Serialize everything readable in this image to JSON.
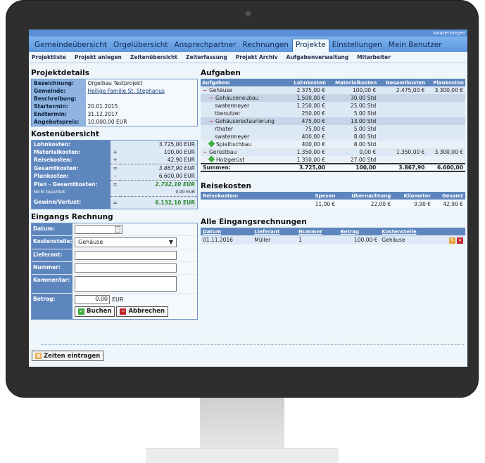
{
  "user": "swatermeyer",
  "main_nav": [
    "Gemeindeübersicht",
    "Orgelübersicht",
    "Ansprechpartner",
    "Rechnungen",
    "Projekte",
    "Einstellungen",
    "Mein Benutzer"
  ],
  "main_nav_active": "Projekte",
  "sub_nav": [
    "Projektliste",
    "Projekt anlegen",
    "Zeitenübersicht",
    "Zeiterfassung",
    "Projekt Archiv",
    "Aufgabenverwaltung",
    "Mitarbeiter"
  ],
  "projektdetails": {
    "title": "Projektdetails",
    "rows": [
      {
        "k": "Bezeichnung:",
        "v": "Orgelbau Testprojekt"
      },
      {
        "k": "Gemeinde:",
        "v": "Heilige Familie St. Stephanus"
      },
      {
        "k": "Beschreibung:",
        "v": ""
      },
      {
        "k": "Startermin:",
        "v": "20.01.2015"
      },
      {
        "k": "Endtermin:",
        "v": "31.12.2017"
      },
      {
        "k": "Angebotspreis:",
        "v": "10.000,00 EUR"
      }
    ]
  },
  "kosten": {
    "title": "Kostenübersicht",
    "rows": [
      {
        "k": "Lohnkosten:",
        "op": "",
        "v": "3.725,00 EUR"
      },
      {
        "k": "Materialkosten:",
        "op": "+",
        "v": "100,00 EUR"
      },
      {
        "k": "Reisekosten:",
        "op": "+",
        "v": "42,90 EUR"
      },
      {
        "k": "Gesamtkosten:",
        "op": "=",
        "v": "3.867,90 EUR"
      },
      {
        "k": "Plankosten:",
        "op": "-",
        "v": "6.600,00 EUR"
      },
      {
        "k": "Plan - Gesamtkosten:",
        "op": "=",
        "v": "2.732,10 EUR"
      },
      {
        "k": "Nicht beachtet:",
        "op": "",
        "v": "0,00 EUR"
      },
      {
        "k": "Gewinn/Verlust:",
        "op": "=",
        "v": "6.132,10 EUR"
      }
    ]
  },
  "eingang": {
    "title": "Eingangs Rechnung",
    "labels": {
      "datum": "Datum:",
      "kostenstelle": "Kostenstelle:",
      "lieferant": "Lieferant:",
      "nummer": "Nummer:",
      "kommentar": "Kommentar:",
      "betrag": "Betrag:"
    },
    "kostenstelle_value": "Gehäuse",
    "betrag_value": "0.00",
    "currency": "EUR",
    "buchen": "Buchen",
    "abbrechen": "Abbrechen"
  },
  "aufgaben": {
    "title": "Aufgaben",
    "headers": [
      "Aufgaben:",
      "Lohnkosten",
      "Materialkosten",
      "Gesamtkosten",
      "Plankosten"
    ],
    "rows": [
      {
        "level": 0,
        "marker": "minus",
        "name": "Gehäuse",
        "lohn": "2.375,00 €",
        "mat": "100,00 €",
        "ges": "2.475,00 €",
        "plan": "3.300,00 €"
      },
      {
        "level": 2,
        "marker": "minus",
        "name": "Gehäuseneubau",
        "lohn": "1.500,00 €",
        "mat": "30.00 Std",
        "ges": "",
        "plan": ""
      },
      {
        "level": 3,
        "marker": "",
        "name": "swatermeyer",
        "lohn": "1.250,00 €",
        "mat": "25.00 Std",
        "ges": "",
        "plan": ""
      },
      {
        "level": 3,
        "marker": "",
        "name": "tbenutzer",
        "lohn": "250,00 €",
        "mat": "5.00 Std",
        "ges": "",
        "plan": ""
      },
      {
        "level": 2,
        "marker": "minus",
        "name": "Gehäuserestaurierung",
        "lohn": "475,00 €",
        "mat": "13.00 Std",
        "ges": "",
        "plan": ""
      },
      {
        "level": 3,
        "marker": "",
        "name": "rthater",
        "lohn": "75,00 €",
        "mat": "5.00 Std",
        "ges": "",
        "plan": ""
      },
      {
        "level": 3,
        "marker": "",
        "name": "swatermeyer",
        "lohn": "400,00 €",
        "mat": "8.00 Std",
        "ges": "",
        "plan": ""
      },
      {
        "level": 1,
        "marker": "diamond",
        "name": "Spieltischbau",
        "lohn": "400,00 €",
        "mat": "8.00 Std",
        "ges": "",
        "plan": ""
      },
      {
        "level": 0,
        "marker": "minus",
        "name": "Gerüstbau",
        "lohn": "1.350,00 €",
        "mat": "0,00 €",
        "ges": "1.350,00 €",
        "plan": "3.300,00 €"
      },
      {
        "level": 1,
        "marker": "diamond",
        "name": "Holzgerüst",
        "lohn": "1.350,00 €",
        "mat": "27.00 Std",
        "ges": "",
        "plan": ""
      }
    ],
    "sum": {
      "label": "Summen:",
      "lohn": "3.725,00",
      "mat": "100,00",
      "ges": "3.867,90",
      "plan": "6.600,00"
    }
  },
  "reise": {
    "title": "Reisekosten",
    "headers": [
      "Reisekosten:",
      "Spesen",
      "Übernachtung",
      "Kilometer",
      "Gesamt"
    ],
    "row": [
      "",
      "11,00 €",
      "22,00 €",
      "9,90 €",
      "42,90 €"
    ]
  },
  "alle": {
    "title": "Alle Eingangsrechnungen",
    "headers": [
      "Datum",
      "Lieferant",
      "Nummer",
      "Betrag",
      "Kostenstelle"
    ],
    "rows": [
      [
        "01.11.2016",
        "Müller",
        "1",
        "100,00 €",
        "Gehäuse"
      ]
    ]
  },
  "zeiten_button": "Zeiten eintragen",
  "colors": {
    "nav": "#6ea7e8",
    "header": "#5e86be",
    "accent_green": "#2c8a2c",
    "minus": "#c0262d"
  }
}
